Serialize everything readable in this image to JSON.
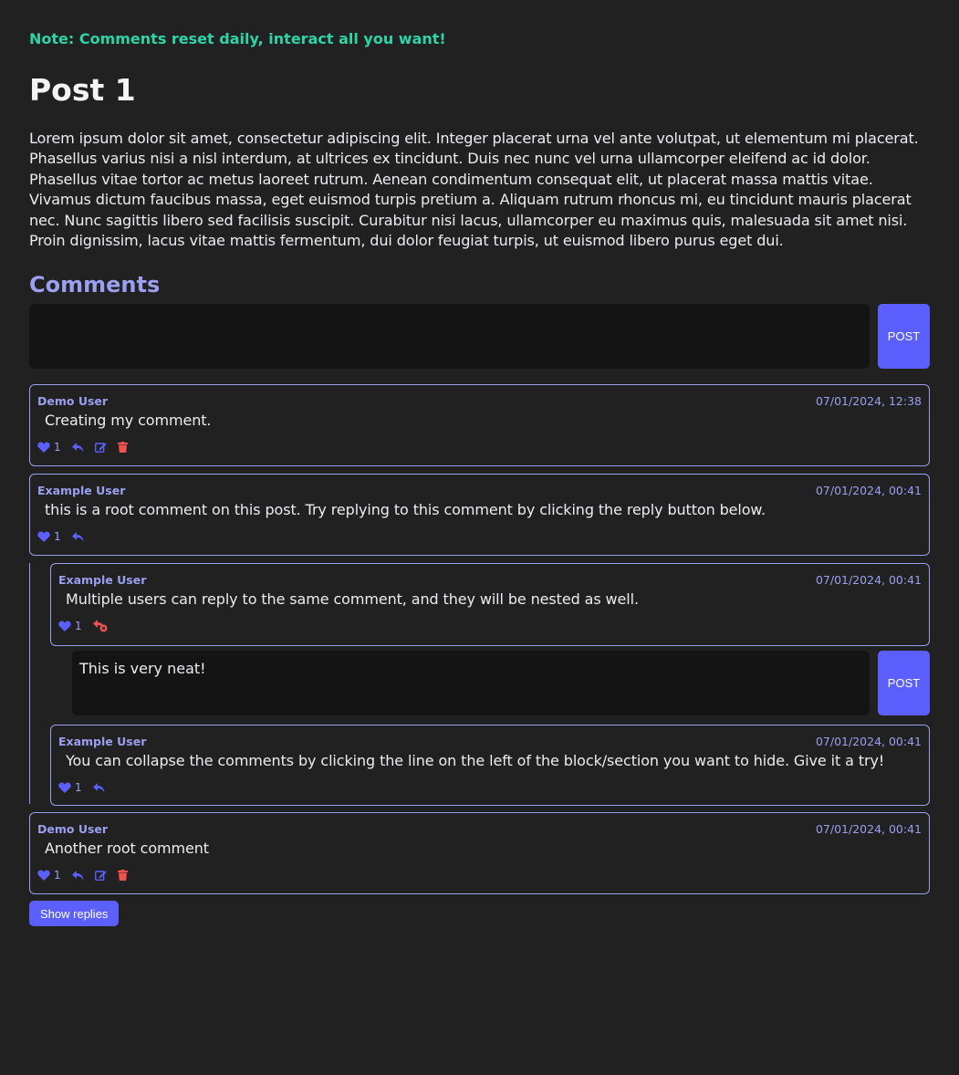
{
  "note": "Note: Comments reset daily, interact all you want!",
  "post": {
    "title": "Post 1",
    "body": "Lorem ipsum dolor sit amet, consectetur adipiscing elit. Integer placerat urna vel ante volutpat, ut elementum mi placerat. Phasellus varius nisi a nisl interdum, at ultrices ex tincidunt. Duis nec nunc vel urna ullamcorper eleifend ac id dolor. Phasellus vitae tortor ac metus laoreet rutrum. Aenean condimentum consequat elit, ut placerat massa mattis vitae. Vivamus dictum faucibus massa, eget euismod turpis pretium a. Aliquam rutrum rhoncus mi, eu tincidunt mauris placerat nec. Nunc sagittis libero sed facilisis suscipit. Curabitur nisi lacus, ullamcorper eu maximus quis, malesuada sit amet nisi. Proin dignissim, lacus vitae mattis fermentum, dui dolor feugiat turpis, ut euismod libero purus eget dui."
  },
  "comments_section": {
    "title": "Comments",
    "composer": {
      "value": "",
      "post_label": "POST"
    },
    "show_replies_label": "Show replies"
  },
  "comments": [
    {
      "author": "Demo User",
      "timestamp": "07/01/2024, 12:38",
      "text": "Creating my comment.",
      "likes": "1"
    },
    {
      "author": "Example User",
      "timestamp": "07/01/2024, 00:41",
      "text": "this is a root comment on this post. Try replying to this comment by clicking the reply button below.",
      "likes": "1"
    },
    {
      "author": "Example User",
      "timestamp": "07/01/2024, 00:41",
      "text": "Multiple users can reply to the same comment, and they will be nested as well.",
      "likes": "1"
    },
    {
      "author": "Example User",
      "timestamp": "07/01/2024, 00:41",
      "text": "You can collapse the comments by clicking the line on the left of the block/section you want to hide. Give it a try!",
      "likes": "1"
    },
    {
      "author": "Demo User",
      "timestamp": "07/01/2024, 00:41",
      "text": "Another root comment",
      "likes": "1"
    }
  ],
  "reply_composer": {
    "value": "This is very neat!",
    "post_label": "POST"
  },
  "colors": {
    "background": "#212121",
    "accent": "#5b5ffd",
    "author": "#9b9ff0",
    "note": "#2dd4a6",
    "delete": "#f05252"
  },
  "icons": {
    "like": "heart-icon",
    "reply": "reply-icon",
    "edit": "edit-icon",
    "delete": "trash-icon",
    "cancel_reply": "cancel-reply-icon"
  }
}
